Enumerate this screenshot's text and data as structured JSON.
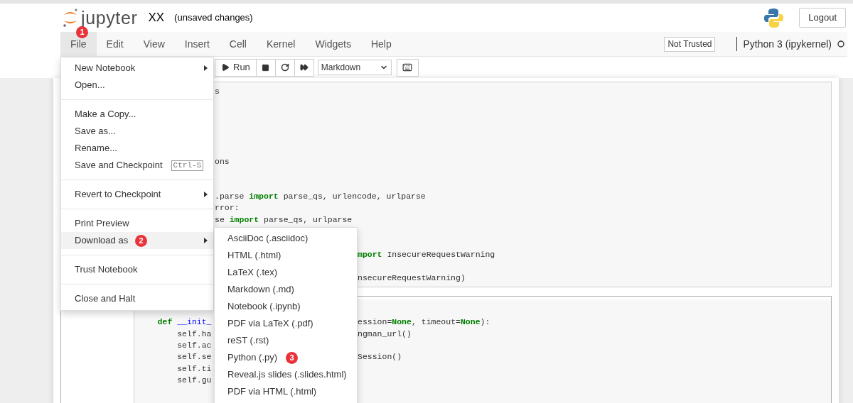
{
  "header": {
    "logo_text": "jupyter",
    "notebook_name": "XX",
    "save_status": "(unsaved changes)",
    "logout": "Logout"
  },
  "menubar": {
    "items": [
      {
        "label": "File",
        "selected": true,
        "badge": "1"
      },
      {
        "label": "Edit",
        "selected": false
      },
      {
        "label": "View",
        "selected": false
      },
      {
        "label": "Insert",
        "selected": false
      },
      {
        "label": "Cell",
        "selected": false
      },
      {
        "label": "Kernel",
        "selected": false
      },
      {
        "label": "Widgets",
        "selected": false
      },
      {
        "label": "Help",
        "selected": false
      }
    ],
    "trust": "Not Trusted",
    "kernel": "Python 3 (ipykernel)"
  },
  "toolbar": {
    "run": "Run",
    "cell_type": "Markdown"
  },
  "file_menu": {
    "items": [
      {
        "kind": "item",
        "label": "New Notebook",
        "submenu": true,
        "selected": false
      },
      {
        "kind": "item",
        "label": "Open...",
        "submenu": false,
        "selected": false
      },
      {
        "kind": "divider"
      },
      {
        "kind": "item",
        "label": "Make a Copy...",
        "submenu": false,
        "selected": false
      },
      {
        "kind": "item",
        "label": "Save as...",
        "submenu": false,
        "selected": false
      },
      {
        "kind": "item",
        "label": "Rename...",
        "submenu": false,
        "selected": false
      },
      {
        "kind": "item",
        "label": "Save and Checkpoint",
        "shortcut": "Ctrl-S",
        "submenu": false,
        "selected": false
      },
      {
        "kind": "divider"
      },
      {
        "kind": "item",
        "label": "Revert to Checkpoint",
        "submenu": true,
        "selected": false
      },
      {
        "kind": "divider"
      },
      {
        "kind": "item",
        "label": "Print Preview",
        "submenu": false,
        "selected": false
      },
      {
        "kind": "item",
        "label": "Download as",
        "submenu": true,
        "selected": true,
        "badge": "2"
      },
      {
        "kind": "divider"
      },
      {
        "kind": "item",
        "label": "Trust Notebook",
        "submenu": false,
        "selected": false
      },
      {
        "kind": "divider"
      },
      {
        "kind": "item",
        "label": "Close and Halt",
        "submenu": false,
        "selected": false
      }
    ]
  },
  "download_menu": {
    "items": [
      {
        "label": "AsciiDoc (.asciidoc)"
      },
      {
        "label": "HTML (.html)"
      },
      {
        "label": "LaTeX (.tex)"
      },
      {
        "label": "Markdown (.md)"
      },
      {
        "label": "Notebook (.ipynb)"
      },
      {
        "label": "PDF via LaTeX (.pdf)"
      },
      {
        "label": "reST (.rst)"
      },
      {
        "label": "Python (.py)",
        "badge": "3"
      },
      {
        "label": "Reveal.js slides (.slides.html)"
      },
      {
        "label": "PDF via HTML (.html)"
      }
    ]
  },
  "cells": [
    {
      "lines": [
        {
          "segments": [
            {
              "tokens": [
                {
                  "kind": "plain",
                  "text": "s"
                }
              ]
            }
          ]
        },
        {
          "segments": [
            {
              "tokens": [
                {
                  "kind": "plain",
                  "text": "ons"
                }
              ]
            }
          ]
        },
        {
          "segments": [
            {
              "tokens": [
                {
                  "kind": "plain",
                  "text": ".parse "
                },
                {
                  "kind": "keyword",
                  "text": "import"
                },
                {
                  "kind": "plain",
                  "text": " parse_qs, urlencode, urlparse"
                }
              ]
            }
          ]
        },
        {
          "segments": [
            {
              "tokens": [
                {
                  "kind": "plain",
                  "text": "rror:"
                }
              ]
            }
          ]
        },
        {
          "segments": [
            {
              "tokens": [
                {
                  "kind": "plain",
                  "text": "se "
                },
                {
                  "kind": "keyword",
                  "text": "import"
                },
                {
                  "kind": "plain",
                  "text": " parse_qs, urlparse"
                }
              ]
            }
          ]
        },
        {
          "segments": [
            {
              "tokens": [
                {
                  "kind": "keyword",
                  "text": "mport"
                },
                {
                  "kind": "plain",
                  "text": " InsecureRequestWarning"
                }
              ]
            }
          ]
        },
        {
          "segments": [
            {
              "tokens": [
                {
                  "kind": "plain",
                  "text": "nsecureRequestWarning)"
                }
              ]
            }
          ]
        }
      ]
    },
    {
      "lines": [
        {
          "segments": [
            {
              "tokens": [
                {
                  "kind": "keyword",
                  "text": "    def"
                },
                {
                  "kind": "name",
                  "text": " __init_"
                }
              ]
            },
            {
              "tokens": [
                {
                  "kind": "plain",
                  "text": "ession="
                },
                {
                  "kind": "keyword",
                  "text": "None"
                },
                {
                  "kind": "plain",
                  "text": ", timeout="
                },
                {
                  "kind": "keyword",
                  "text": "None"
                },
                {
                  "kind": "plain",
                  "text": "):"
                }
              ]
            }
          ]
        },
        {
          "segments": [
            {
              "tokens": [
                {
                  "kind": "plain",
                  "text": "        self.ha"
                }
              ]
            },
            {
              "tokens": [
                {
                  "kind": "plain",
                  "text": "ngman_url()"
                }
              ]
            }
          ]
        },
        {
          "segments": [
            {
              "tokens": [
                {
                  "kind": "plain",
                  "text": "        self.ac"
                }
              ]
            }
          ]
        },
        {
          "segments": [
            {
              "tokens": [
                {
                  "kind": "plain",
                  "text": "        self.se"
                }
              ]
            },
            {
              "tokens": [
                {
                  "kind": "plain",
                  "text": "Session()"
                }
              ]
            }
          ]
        },
        {
          "segments": [
            {
              "tokens": [
                {
                  "kind": "plain",
                  "text": "        self.ti"
                }
              ]
            }
          ]
        },
        {
          "segments": [
            {
              "tokens": [
                {
                  "kind": "plain",
                  "text": "        self.gu"
                }
              ]
            }
          ]
        }
      ]
    }
  ]
}
